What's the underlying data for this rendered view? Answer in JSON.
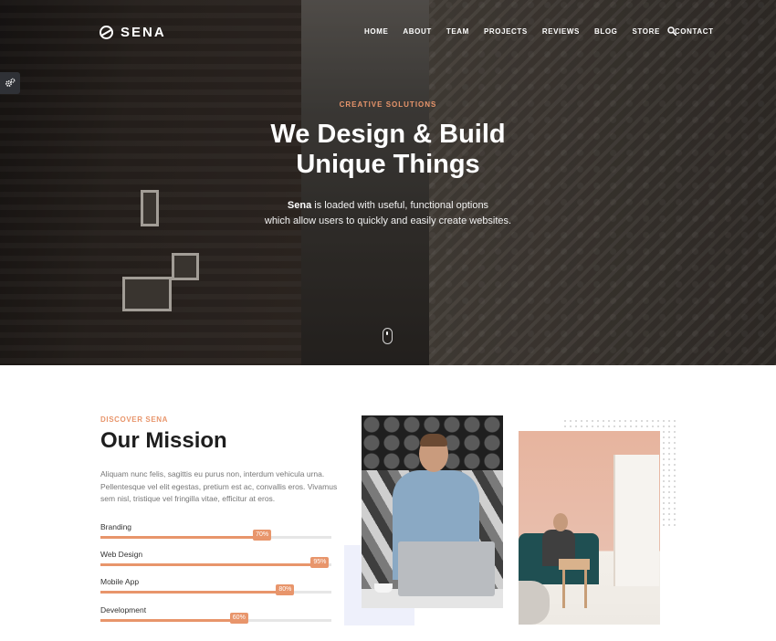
{
  "brand": {
    "name": "SENA"
  },
  "nav": {
    "items": [
      "HOME",
      "ABOUT",
      "TEAM",
      "PROJECTS",
      "REVIEWS",
      "BLOG",
      "STORE",
      "CONTACT"
    ],
    "search_icon": "search-icon"
  },
  "settings": {
    "icon": "gears-icon"
  },
  "hero": {
    "eyebrow": "CREATIVE SOLUTIONS",
    "title_line1": "We Design & Build",
    "title_line2": "Unique Things",
    "desc_brand": "Sena",
    "desc_line1_rest": " is loaded with useful, functional options",
    "desc_line2": "which allow users to quickly and easily create websites."
  },
  "mission": {
    "eyebrow": "DISCOVER SENA",
    "title": "Our Mission",
    "text": "Aliquam nunc felis, sagittis eu purus non, interdum vehicula urna. Pellentesque vel elit egestas, pretium est ac, convallis eros. Vivamus sem nisl, tristique vel fringilla vitae, efficitur at eros.",
    "skills": [
      {
        "label": "Branding",
        "value": 70,
        "badge": "70%"
      },
      {
        "label": "Web Design",
        "value": 95,
        "badge": "95%"
      },
      {
        "label": "Mobile App",
        "value": 80,
        "badge": "80%"
      },
      {
        "label": "Development",
        "value": 60,
        "badge": "60%"
      }
    ]
  },
  "colors": {
    "accent": "#e8956b",
    "hero_text": "#ffffff",
    "heading": "#1e1e1e",
    "body_text": "#777777",
    "track": "#e6e6e6"
  }
}
